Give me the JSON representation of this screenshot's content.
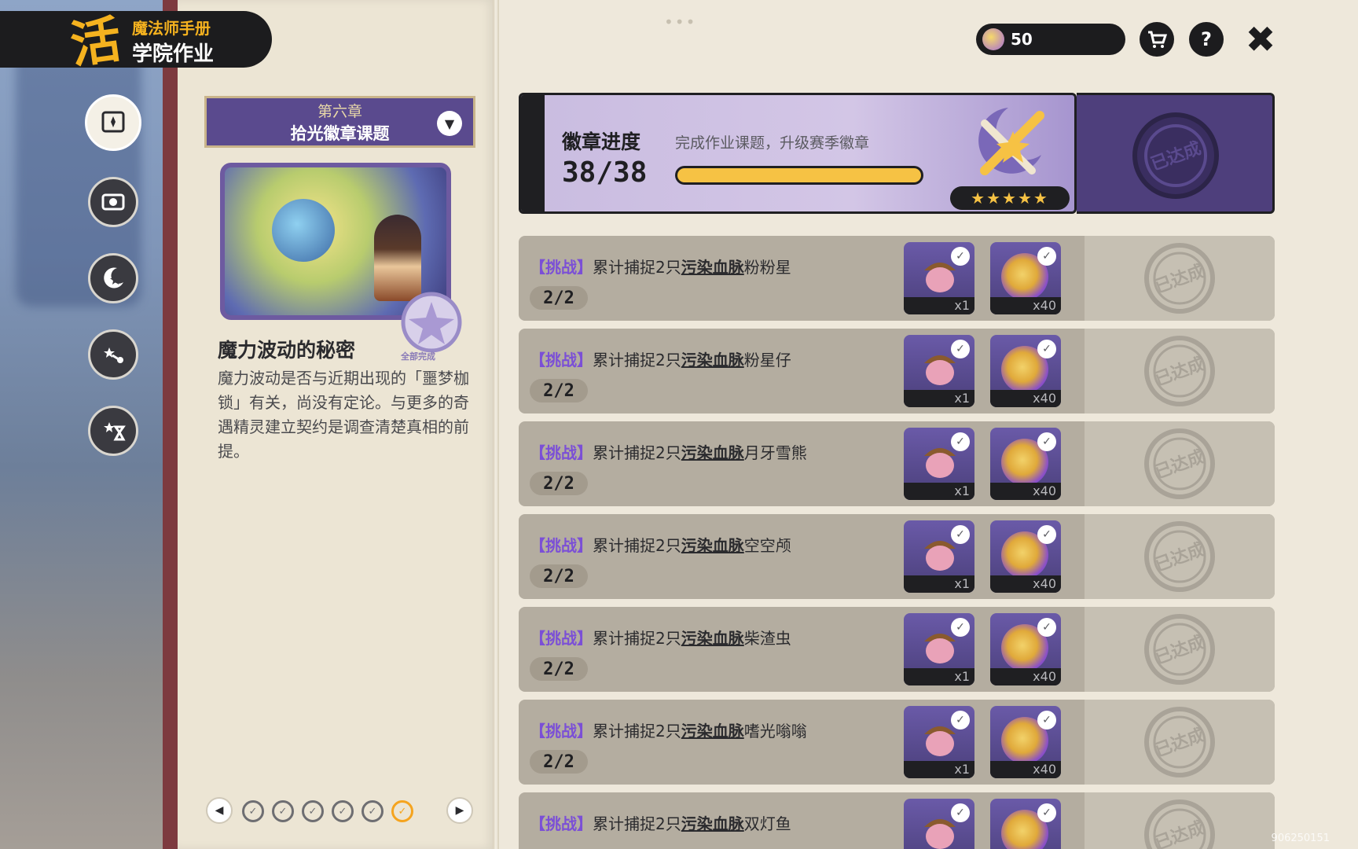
{
  "header": {
    "logo_text": "活",
    "title_line1": "魔法师手册",
    "title_line2": "学院作业"
  },
  "side_nav": [
    {
      "icon": "compass-book-icon",
      "active": true
    },
    {
      "icon": "fist-scroll-icon",
      "active": false
    },
    {
      "icon": "star-moon-icon",
      "active": false
    },
    {
      "icon": "star-branch-icon",
      "active": false
    },
    {
      "icon": "star-hourglass-icon",
      "active": false
    }
  ],
  "chapter": {
    "number": "第六章",
    "name": "拾光徽章课题"
  },
  "story": {
    "complete_badge": "全部完成",
    "title": "魔力波动的秘密",
    "text": "魔力波动是否与近期出现的「噩梦枷锁」有关，尚没有定论。与更多的奇遇精灵建立契约是调查清楚真相的前提。"
  },
  "pager": {
    "total_chapters": 6,
    "current_chapter": 6
  },
  "hud": {
    "currency_value": "50",
    "menu_dots": "•••"
  },
  "badge_progress": {
    "title": "徽章进度",
    "subtitle": "完成作业课题，升级赛季徽章",
    "count": "38/38",
    "progress": 1.0,
    "stars": "★★★★★",
    "stamp_text": "已达成"
  },
  "tasks": [
    {
      "tag": "【挑战】",
      "text": "累计捕捉2只",
      "highlight": "污染血脉",
      "target": "粉粉星",
      "progress": "2/2",
      "reward1_qty": "x1",
      "reward2_qty": "x40",
      "stamp": "已达成"
    },
    {
      "tag": "【挑战】",
      "text": "累计捕捉2只",
      "highlight": "污染血脉",
      "target": "粉星仔",
      "progress": "2/2",
      "reward1_qty": "x1",
      "reward2_qty": "x40",
      "stamp": "已达成"
    },
    {
      "tag": "【挑战】",
      "text": "累计捕捉2只",
      "highlight": "污染血脉",
      "target": "月牙雪熊",
      "progress": "2/2",
      "reward1_qty": "x1",
      "reward2_qty": "x40",
      "stamp": "已达成"
    },
    {
      "tag": "【挑战】",
      "text": "累计捕捉2只",
      "highlight": "污染血脉",
      "target": "空空颅",
      "progress": "2/2",
      "reward1_qty": "x1",
      "reward2_qty": "x40",
      "stamp": "已达成"
    },
    {
      "tag": "【挑战】",
      "text": "累计捕捉2只",
      "highlight": "污染血脉",
      "target": "柴渣虫",
      "progress": "2/2",
      "reward1_qty": "x1",
      "reward2_qty": "x40",
      "stamp": "已达成"
    },
    {
      "tag": "【挑战】",
      "text": "累计捕捉2只",
      "highlight": "污染血脉",
      "target": "嗜光嗡嗡",
      "progress": "2/2",
      "reward1_qty": "x1",
      "reward2_qty": "x40",
      "stamp": "已达成"
    },
    {
      "tag": "【挑战】",
      "text": "累计捕捉2只",
      "highlight": "污染血脉",
      "target": "双灯鱼",
      "progress": "",
      "reward1_qty": "",
      "reward2_qty": "",
      "stamp": "已达成"
    }
  ],
  "watermark": "906250151",
  "colors": {
    "accent_purple": "#7b4fd6",
    "gold": "#f6c244",
    "panel_dark": "#1f1f22"
  }
}
